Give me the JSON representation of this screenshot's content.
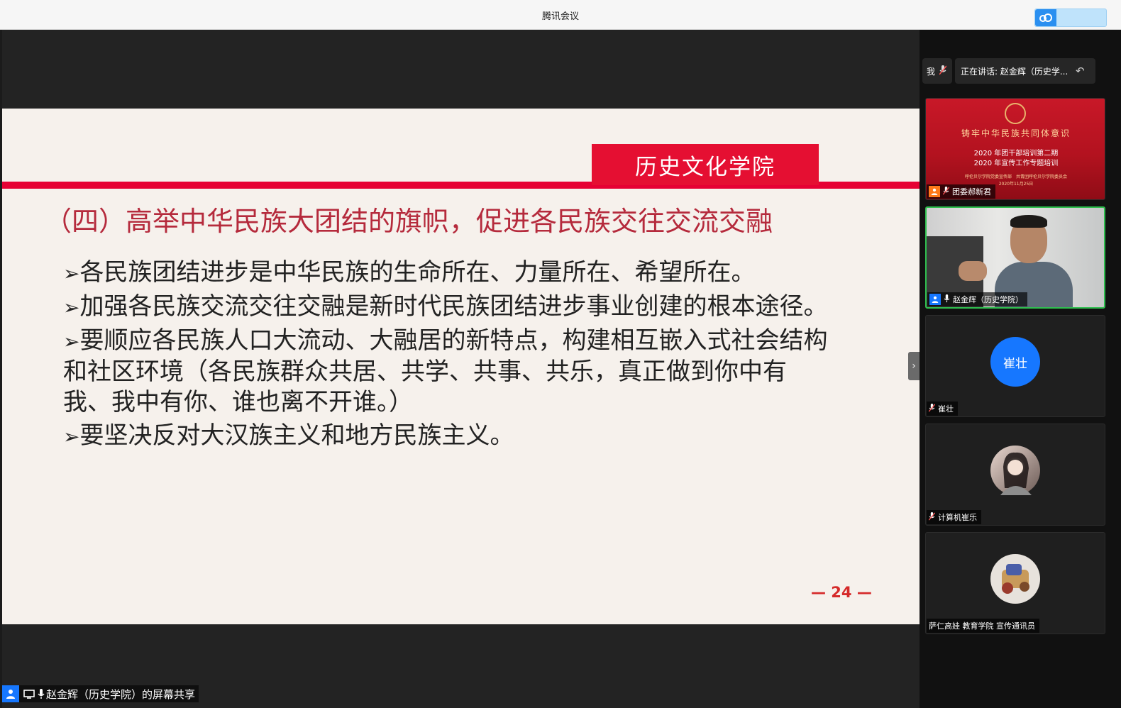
{
  "window": {
    "title": "腾讯会议"
  },
  "slide": {
    "school_tag": "历史文化学院",
    "heading": "（四）高举中华民族大团结的旗帜，促进各民族交往交流交融",
    "bullets": [
      "各民族团结进步是中华民族的生命所在、力量所在、希望所在。",
      "加强各民族交流交往交融是新时代民族团结进步事业创建的根本途径。",
      "要顺应各民族人口大流动、大融居的新特点，构建相互嵌入式社会结构和社区环境（各民族群众共居、共学、共事、共乐，真正做到你中有我、我中有你、谁也离不开谁。）",
      "要坚决反对大汉族主义和地方民族主义。"
    ],
    "bullet_marker": "➢",
    "page_number": "— 24 —"
  },
  "share_bar": {
    "label": "赵金辉（历史学院）的屏幕共享"
  },
  "panel": {
    "me_label": "我",
    "speaking_label": "正在讲话: 赵金辉（历史学...",
    "tiles": [
      {
        "name": "团委郝新君",
        "poster": {
          "line1": "铸牢中华民族共同体意识",
          "line2": "2020 年团干部培训第二期",
          "line3": "2020 年宣传工作专题培训",
          "line4": "呼伦贝尔学院党委宣传部　共青团呼伦贝尔学院委员会",
          "line5": "2020年11月25日"
        }
      },
      {
        "name": "赵金辉（历史学院）"
      },
      {
        "name": "崔壮",
        "avatar_text": "崔壮",
        "avatar_color": "#1677ff"
      },
      {
        "name": "计算机崔乐"
      },
      {
        "name": "萨仁高娃 教育学院 宣传通讯员"
      }
    ]
  },
  "icons": {
    "cloud": "cloud-icon",
    "mic": "mic-icon",
    "mic_muted": "mic-muted-icon",
    "user": "user-icon",
    "screen_share": "screen-share-icon",
    "collapse": "chevron-right-icon",
    "back": "reply-icon"
  },
  "colors": {
    "accent_red": "#e50f32",
    "active_border": "#2fbf4f",
    "avatar_blue": "#1677ff"
  }
}
